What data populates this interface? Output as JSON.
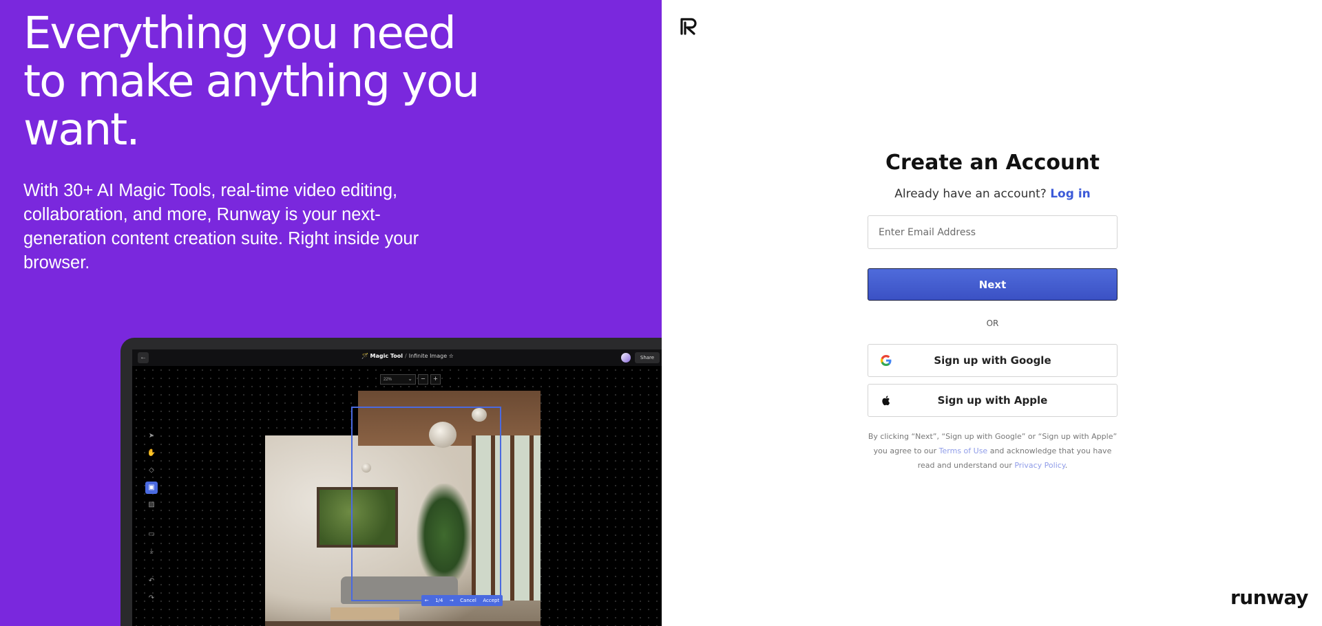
{
  "hero": {
    "title": "Everything you need to make anything you want.",
    "subtitle": "With 30+ AI Magic Tools, real-time video editing, collaboration, and more, Runway is your next-generation content creation suite. Right inside your browser."
  },
  "mockup": {
    "back": "←",
    "crumb_tool": "Magic Tool",
    "crumb_sep": "/",
    "crumb_page": "Infinite Image",
    "star": "☆",
    "share": "Share",
    "zoom": "22%",
    "zoom_out": "−",
    "zoom_in": "+",
    "pager": "1/4",
    "prev": "←",
    "next": "→",
    "cancel": "Cancel",
    "accept": "Accept",
    "tools": [
      "➤",
      "✋",
      "◇",
      "▣",
      "▨",
      "▭",
      "⤓",
      "↶",
      "↷"
    ]
  },
  "form": {
    "title": "Create an Account",
    "login_prompt": "Already have an account?",
    "login_link": "Log in",
    "email_placeholder": "Enter Email Address",
    "next_label": "Next",
    "or_label": "OR",
    "google_label": "Sign up with Google",
    "apple_label": "Sign up with Apple",
    "terms_prefix": "By clicking “Next”, “Sign up with Google” or “Sign up with Apple” you agree to our",
    "terms_link": "Terms of Use",
    "terms_middle": "and acknowledge that you have read and understand our",
    "privacy_link": "Privacy Policy",
    "terms_suffix": "."
  },
  "brand": {
    "name": "runway"
  },
  "colors": {
    "accent": "#7a28dd",
    "button": "#3f59d0",
    "link": "#3c5ad8"
  },
  "icons": [
    "runway-logo-icon",
    "google-icon",
    "apple-icon"
  ]
}
